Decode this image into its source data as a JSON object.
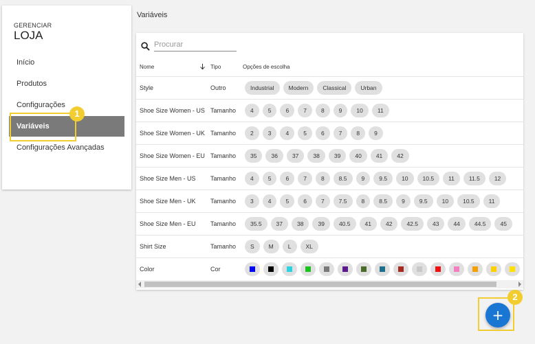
{
  "sidebar": {
    "brand_small": "GERENCIAR",
    "brand_big": "LOJA",
    "items": [
      {
        "label": "Início"
      },
      {
        "label": "Produtos"
      },
      {
        "label": "Configurações"
      },
      {
        "label": "Variáveis",
        "active": true
      },
      {
        "label": "Configurações Avançadas"
      }
    ]
  },
  "badges": {
    "one": "1",
    "two": "2"
  },
  "main": {
    "title": "Variáveis",
    "search": {
      "placeholder": "Procurar",
      "value": "",
      "icon": "search-icon"
    },
    "columns": {
      "name": "Nome",
      "type": "Tipo",
      "options": "Opções de escolha"
    },
    "rows": [
      {
        "name": "Style",
        "type": "Outro",
        "options": [
          "Industrial",
          "Modern",
          "Classical",
          "Urban"
        ]
      },
      {
        "name": "Shoe Size Women - US",
        "type": "Tamanho",
        "options": [
          "4",
          "5",
          "6",
          "7",
          "8",
          "9",
          "10",
          "11"
        ]
      },
      {
        "name": "Shoe Size Women - UK",
        "type": "Tamanho",
        "options": [
          "2",
          "3",
          "4",
          "5",
          "6",
          "7",
          "8",
          "9"
        ]
      },
      {
        "name": "Shoe Size Women - EU",
        "type": "Tamanho",
        "options": [
          "35",
          "36",
          "37",
          "38",
          "39",
          "40",
          "41",
          "42"
        ]
      },
      {
        "name": "Shoe Size Men - US",
        "type": "Tamanho",
        "options": [
          "4",
          "5",
          "6",
          "7",
          "8",
          "8.5",
          "9",
          "9.5",
          "10",
          "10.5",
          "11",
          "11.5",
          "12"
        ]
      },
      {
        "name": "Shoe Size Men - UK",
        "type": "Tamanho",
        "options": [
          "3",
          "4",
          "5",
          "6",
          "7",
          "7.5",
          "8",
          "8.5",
          "9",
          "9.5",
          "10",
          "10.5",
          "11"
        ]
      },
      {
        "name": "Shoe Size Men - EU",
        "type": "Tamanho",
        "options": [
          "35.5",
          "37",
          "38",
          "39",
          "40.5",
          "41",
          "42",
          "42.5",
          "43",
          "44",
          "44.5",
          "45"
        ]
      },
      {
        "name": "Shirt Size",
        "type": "Tamanho",
        "options": [
          "S",
          "M",
          "L",
          "XL"
        ]
      },
      {
        "name": "Color",
        "type": "Cor",
        "colors": [
          "#0000ff",
          "#000000",
          "#29d3e3",
          "#1fbf1f",
          "#7a7a7a",
          "#5a1a8a",
          "#4b6b2a",
          "#1e6e8c",
          "#a52a1f",
          "#c8c8c8",
          "#ee1111",
          "#f080c0",
          "#f5a000",
          "#ffd000",
          "#ffe000"
        ]
      }
    ]
  },
  "fab": {
    "label": "+"
  }
}
